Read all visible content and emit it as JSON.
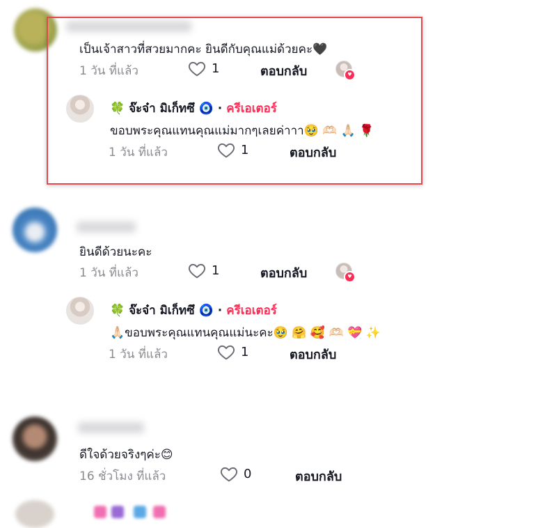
{
  "comments": [
    {
      "text": "เป็นเจ้าสาวที่สวยมากคะ ยินดีกับคุณแม่ด้วยคะ🖤",
      "time": "1 วัน ที่แล้ว",
      "likes": "1",
      "reply_label": "ตอบกลับ",
      "reply": {
        "author": "🍀 จ๊ะจ๋า มิเก็ทซึ 🧿",
        "separator": "·",
        "badge": "ครีเอเตอร์",
        "text": "ขอบพระคุณแทนคุณแม่มากๆเลยค่าาา🥹 🫶🏻 🙏🏻 🌹",
        "time": "1 วัน ที่แล้ว",
        "likes": "1",
        "reply_label": "ตอบกลับ"
      }
    },
    {
      "text": "ยินดีด้วยนะคะ",
      "time": "1 วัน ที่แล้ว",
      "likes": "1",
      "reply_label": "ตอบกลับ",
      "reply": {
        "author": "🍀 จ๊ะจ๋า มิเก็ทซึ 🧿",
        "separator": "·",
        "badge": "ครีเอเตอร์",
        "text": "🙏🏻ขอบพระคุณแทนคุณแม่นะคะ🥹 🤗 🥰 🫶🏻 💝 ✨",
        "time": "1 วัน ที่แล้ว",
        "likes": "1",
        "reply_label": "ตอบกลับ"
      }
    },
    {
      "text": "ดีใจด้วยจริงๆค่ะ😊",
      "time": "16 ชั่วโมง ที่แล้ว",
      "likes": "0",
      "reply_label": "ตอบกลับ"
    }
  ],
  "colors": {
    "creator_badge": "#fe2c55",
    "highlight_border": "#e5484d",
    "meta_text": "#8a8b91"
  },
  "icons": {
    "like": "heart-outline-icon",
    "creator_liked": "heart-badge-icon"
  }
}
